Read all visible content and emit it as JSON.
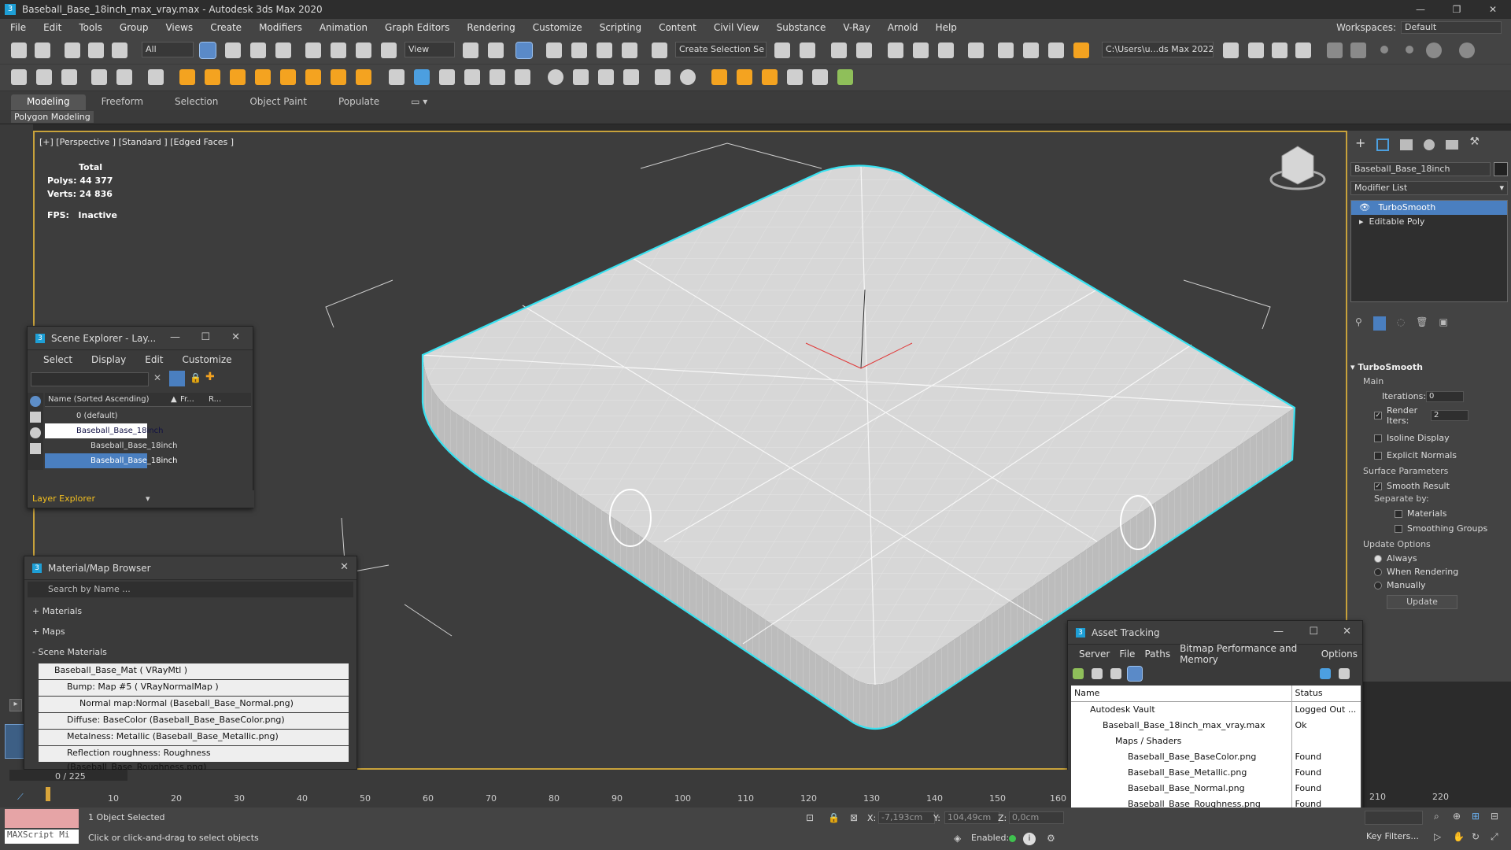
{
  "window": {
    "title": "Baseball_Base_18inch_max_vray.max - Autodesk 3ds Max 2020"
  },
  "menu": [
    "File",
    "Edit",
    "Tools",
    "Group",
    "Views",
    "Create",
    "Modifiers",
    "Animation",
    "Graph Editors",
    "Rendering",
    "Customize",
    "Scripting",
    "Content",
    "Civil View",
    "Substance",
    "V-Ray",
    "Arnold",
    "Help"
  ],
  "workspaces": {
    "label": "Workspaces:",
    "value": "Default"
  },
  "toolbar": {
    "filter": "All",
    "ref_coord": "View",
    "selection_set": "Create Selection Se",
    "project_path": "C:\\Users\\u...ds Max 2022"
  },
  "ribbon": {
    "tabs": [
      "Modeling",
      "Freeform",
      "Selection",
      "Object Paint",
      "Populate"
    ],
    "active": "Modeling",
    "sub": "Polygon Modeling"
  },
  "viewport": {
    "label": "[+] [Perspective ] [Standard ] [Edged Faces ]",
    "stats_total": "Total",
    "polys_label": "Polys:",
    "polys": "44 377",
    "verts_label": "Verts:",
    "verts": "24 836",
    "fps_label": "FPS:",
    "fps": "Inactive"
  },
  "scene_explorer": {
    "title": "Scene Explorer - Lay...",
    "menu": [
      "Select",
      "Display",
      "Edit",
      "Customize"
    ],
    "col_name": "Name (Sorted Ascending)",
    "col_fr": "Fr...",
    "col_r": "R...",
    "rows": [
      "0 (default)",
      "Baseball_Base_18inch",
      "Baseball_Base_18inch",
      "Baseball_Base_18inch"
    ],
    "footer": "Layer Explorer"
  },
  "material_browser": {
    "title": "Material/Map Browser",
    "search_placeholder": "Search by Name ...",
    "sections": [
      "+ Materials",
      "+ Maps",
      "- Scene Materials"
    ],
    "items": [
      "Baseball_Base_Mat  ( VRayMtl )",
      "Bump: Map #5  ( VRayNormalMap )",
      "Normal map:Normal (Baseball_Base_Normal.png)",
      "Diffuse: BaseColor (Baseball_Base_BaseColor.png)",
      "Metalness: Metallic (Baseball_Base_Metallic.png)",
      "Reflection roughness: Roughness (Baseball_Base_Roughness.png)"
    ]
  },
  "asset_tracking": {
    "title": "Asset Tracking",
    "menu": [
      "Server",
      "File",
      "Paths",
      "Bitmap Performance and Memory",
      "Options"
    ],
    "col_name": "Name",
    "col_status": "Status",
    "rows": [
      {
        "name": "Autodesk Vault",
        "status": "Logged Out ..."
      },
      {
        "name": "Baseball_Base_18inch_max_vray.max",
        "status": "Ok"
      },
      {
        "name": "Maps / Shaders",
        "status": ""
      },
      {
        "name": "Baseball_Base_BaseColor.png",
        "status": "Found"
      },
      {
        "name": "Baseball_Base_Metallic.png",
        "status": "Found"
      },
      {
        "name": "Baseball_Base_Normal.png",
        "status": "Found"
      },
      {
        "name": "Baseball_Base_Roughness.png",
        "status": "Found"
      }
    ]
  },
  "command_panel": {
    "object_name": "Baseball_Base_18inch",
    "modifier_list": "Modifier List",
    "stack": [
      "TurboSmooth",
      "Editable Poly"
    ],
    "rollout": "TurboSmooth",
    "main": "Main",
    "iterations_label": "Iterations:",
    "iterations": "0",
    "render_iters_label": "Render Iters:",
    "render_iters": "2",
    "isoline": "Isoline Display",
    "explicit": "Explicit Normals",
    "surface_params": "Surface Parameters",
    "smooth_result": "Smooth Result",
    "separate_by": "Separate by:",
    "materials": "Materials",
    "smoothing_groups": "Smoothing Groups",
    "update_options": "Update Options",
    "always": "Always",
    "when_rendering": "When Rendering",
    "manually": "Manually",
    "update_btn": "Update"
  },
  "timeline": {
    "counter": "0 / 225",
    "ticks": [
      "0",
      "10",
      "20",
      "30",
      "40",
      "50",
      "60",
      "70",
      "80",
      "90",
      "100",
      "110",
      "120",
      "130",
      "140",
      "150",
      "160",
      "210",
      "220"
    ]
  },
  "status": {
    "maxscript": "MAXScript Mi",
    "selected": "1 Object Selected",
    "hint": "Click or click-and-drag to select objects",
    "x_label": "X:",
    "x": "-7,193cm",
    "y_label": "Y:",
    "y": "104,49cm",
    "z_label": "Z:",
    "z": "0,0cm",
    "enabled": "Enabled:",
    "key_filters": "Key Filters..."
  }
}
